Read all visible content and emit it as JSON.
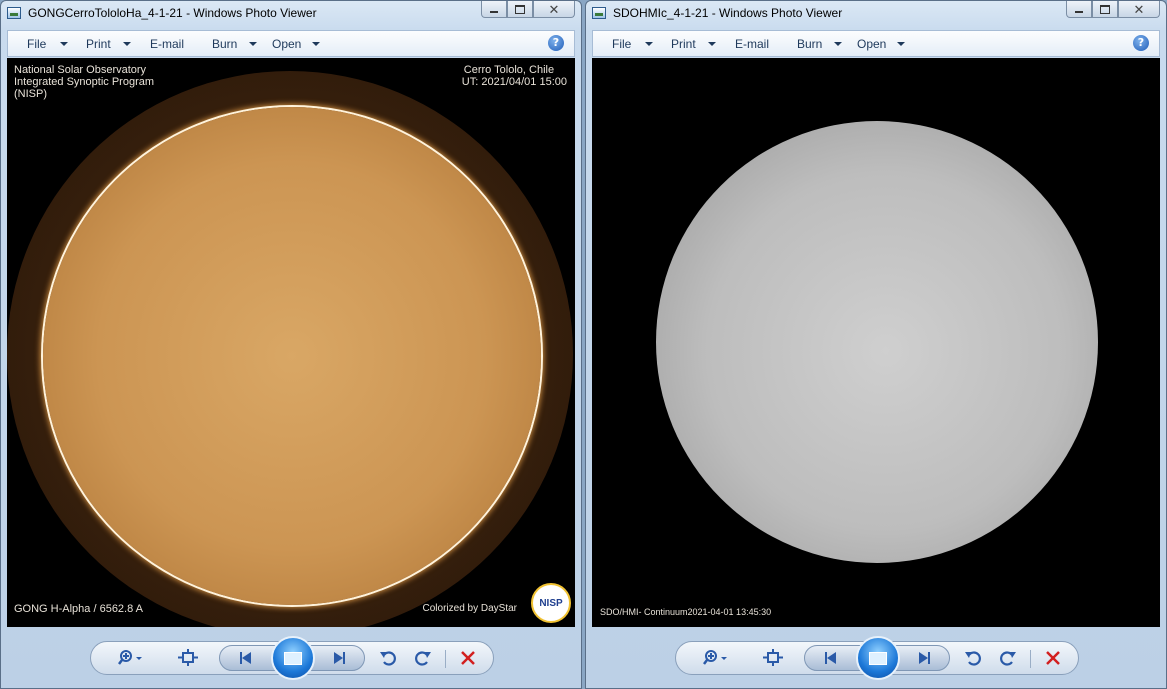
{
  "windows": [
    {
      "title": "GONGCerroTololoHa_4-1-21 - Windows Photo Viewer",
      "menu": [
        {
          "label": "File",
          "has_arrow": true
        },
        {
          "label": "Print",
          "has_arrow": true
        },
        {
          "label": "E-mail",
          "has_arrow": false
        },
        {
          "label": "Burn",
          "has_arrow": true
        },
        {
          "label": "Open",
          "has_arrow": true
        }
      ],
      "image": {
        "top_left": [
          "National Solar Observatory",
          "Integrated Synoptic Program",
          "(NISP)"
        ],
        "top_right": [
          "Cerro Tololo, Chile",
          "UT:  2021/04/01 15:00"
        ],
        "bottom_left": "GONG H-Alpha / 6562.8 A",
        "bottom_right": "Colorized by DayStar",
        "logo_text": "NISP"
      }
    },
    {
      "title": "SDOHMIc_4-1-21 - Windows Photo Viewer",
      "menu": [
        {
          "label": "File",
          "has_arrow": true
        },
        {
          "label": "Print",
          "has_arrow": true
        },
        {
          "label": "E-mail",
          "has_arrow": false
        },
        {
          "label": "Burn",
          "has_arrow": true
        },
        {
          "label": "Open",
          "has_arrow": true
        }
      ],
      "image": {
        "bottom_left": "SDO/HMI- Continuum2021-04-01 13:45:30"
      }
    }
  ],
  "help_symbol": "?",
  "colors": {
    "ha_disk": "#cc9553",
    "continuum_disk": "#bdbdbd",
    "delete_red": "#d21f1f",
    "nav_blue": "#2a5aa8"
  },
  "icons": [
    "zoom-icon",
    "actual-size-icon",
    "previous-icon",
    "slideshow-icon",
    "next-icon",
    "rotate-counterclockwise-icon",
    "rotate-clockwise-icon",
    "delete-icon"
  ]
}
